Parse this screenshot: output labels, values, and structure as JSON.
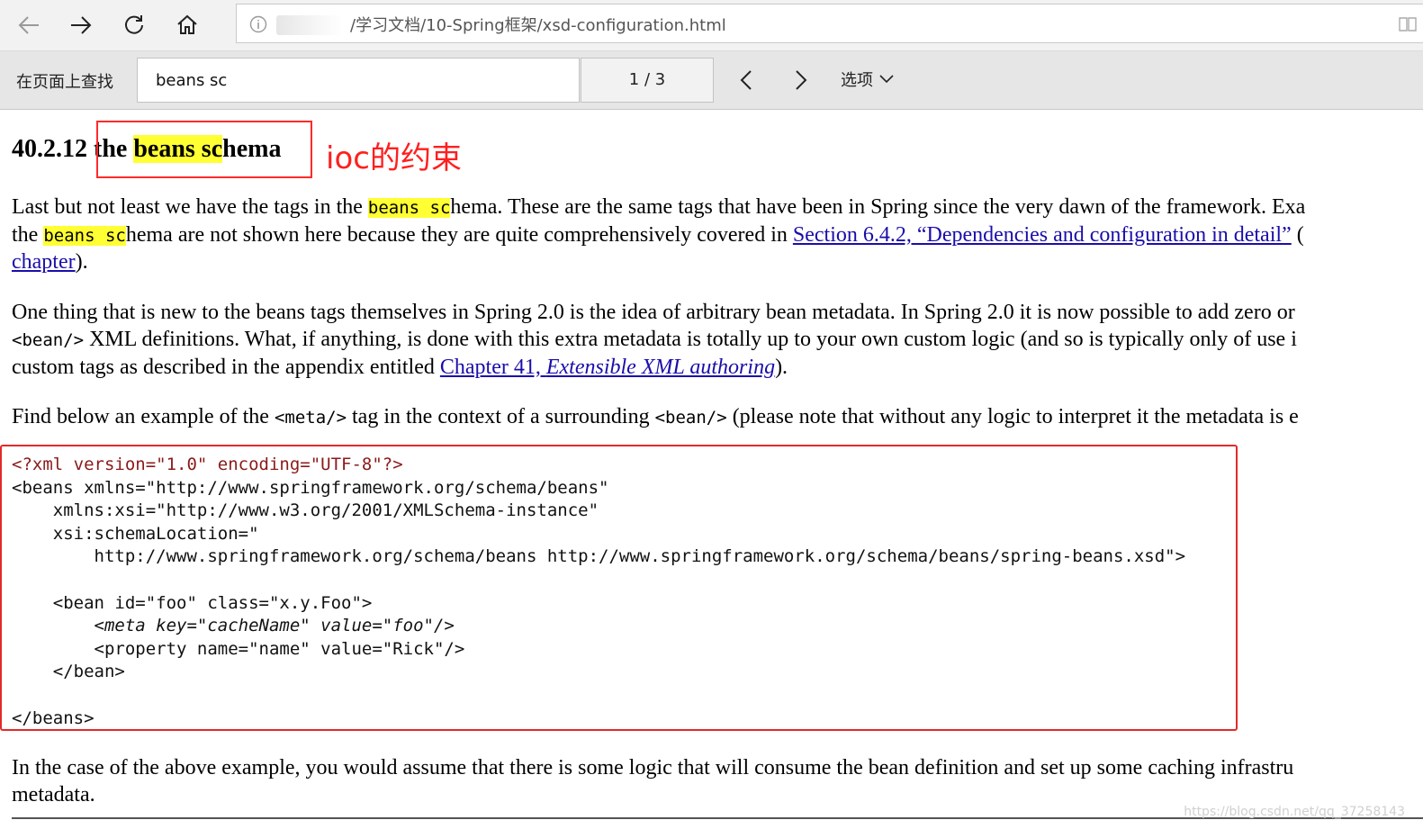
{
  "browser": {
    "url": "/学习文档/10-Spring框架/xsd-configuration.html"
  },
  "findbar": {
    "label": "在页面上查找",
    "query": "beans sc",
    "count": "1 / 3",
    "options": "选项"
  },
  "heading": {
    "number": "40.2.12",
    "pre": "the ",
    "hl": "beans sc",
    "post": "hema"
  },
  "annotation": "ioc的约束",
  "p1": {
    "l1_a": "Last but not least we have the tags in the ",
    "l1_hl": "beans sc",
    "l1_b": "hema. These are the same tags that have been in Spring since the very dawn of the framework. Exa",
    "l2_a": "the ",
    "l2_hl": "beans sc",
    "l2_b": "hema are not shown here because they are quite comprehensively covered in ",
    "l2_link": "Section 6.4.2, “Dependencies and configuration in detail”",
    "l2_c": " (",
    "l3_link": "chapter",
    "l3_b": ")."
  },
  "p2": {
    "l1": "One thing that is new to the beans tags themselves in Spring 2.0 is the idea of arbitrary bean metadata. In Spring 2.0 it is now possible to add zero or",
    "l2_code": "<bean/>",
    "l2_b": " XML definitions. What, if anything, is done with this extra metadata is totally up to your own custom logic (and so is typically only of use i",
    "l3_a": "custom tags as described in the appendix entitled ",
    "l3_link_a": "Chapter 41, ",
    "l3_link_b": "Extensible XML authoring",
    "l3_b": ")."
  },
  "p3": {
    "a": "Find below an example of the ",
    "code1": "<meta/>",
    "b": " tag in the context of a surrounding ",
    "code2": "<bean/>",
    "c": " (please note that without any logic to interpret it the metadata is e"
  },
  "code": {
    "l1": "<?xml version=\"1.0\" encoding=\"UTF-8\"?>",
    "l2": "<beans xmlns=\"http://www.springframework.org/schema/beans\"",
    "l3": "    xmlns:xsi=\"http://www.w3.org/2001/XMLSchema-instance\"",
    "l4": "    xsi:schemaLocation=\"",
    "l5": "        http://www.springframework.org/schema/beans http://www.springframework.org/schema/beans/spring-beans.xsd\">",
    "l6": "",
    "l7": "    <bean id=\"foo\" class=\"x.y.Foo\">",
    "l8": "        <meta key=\"cacheName\" value=\"foo\"/>",
    "l9": "        <property name=\"name\" value=\"Rick\"/>",
    "l10": "    </bean>",
    "l11": "",
    "l12": "</beans>"
  },
  "p4": {
    "l1": "In the case of the above example, you would assume that there is some logic that will consume the bean definition and set up some caching infrastru",
    "l2": "metadata."
  },
  "watermark": "https://blog.csdn.net/qq_37258143",
  "icons": [
    "back-arrow-icon",
    "forward-arrow-icon",
    "refresh-icon",
    "home-icon",
    "info-icon",
    "reading-view-icon",
    "chevron-left-icon",
    "chevron-right-icon",
    "chevron-down-icon"
  ],
  "colors": {
    "highlight": "#ffff33",
    "annotation": "#ff1f1f",
    "link": "#1a0dab",
    "box": "#e22a2a"
  }
}
